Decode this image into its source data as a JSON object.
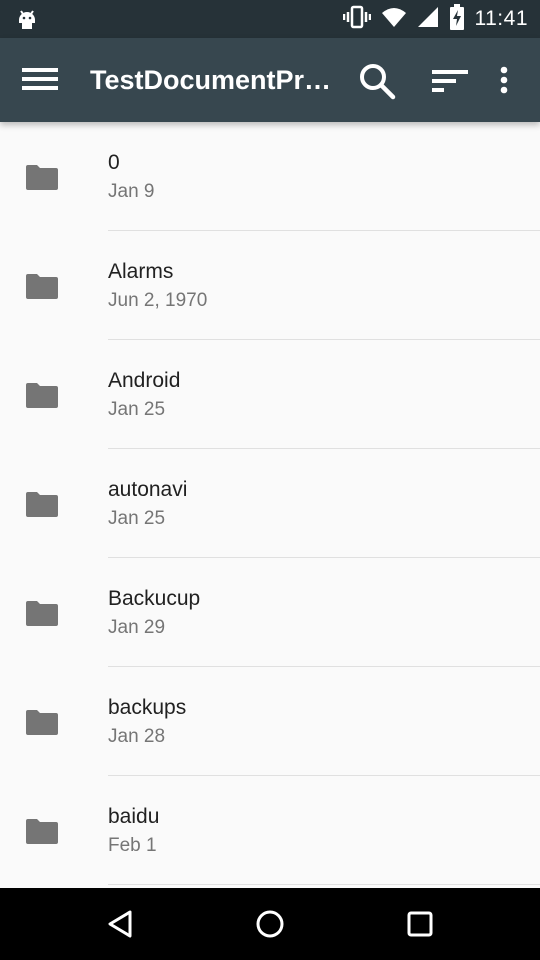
{
  "status_bar": {
    "time": "11:41",
    "icons": [
      "android-icon",
      "vibrate-icon",
      "wifi-icon",
      "signal-icon",
      "battery-charging-icon"
    ]
  },
  "app_bar": {
    "title": "TestDocumentPr…",
    "icons": [
      "menu-icon",
      "search-icon",
      "sort-icon",
      "more-vert-icon"
    ],
    "background": "#37474f"
  },
  "files": [
    {
      "name": "0",
      "date": "Jan 9"
    },
    {
      "name": "Alarms",
      "date": "Jun 2, 1970"
    },
    {
      "name": "Android",
      "date": "Jan 25"
    },
    {
      "name": "autonavi",
      "date": "Jan 25"
    },
    {
      "name": "Backucup",
      "date": "Jan 29"
    },
    {
      "name": "backups",
      "date": "Jan 28"
    },
    {
      "name": "baidu",
      "date": "Feb 1"
    }
  ],
  "nav_bar": {
    "icons": [
      "back-icon",
      "home-icon",
      "recents-icon"
    ]
  }
}
